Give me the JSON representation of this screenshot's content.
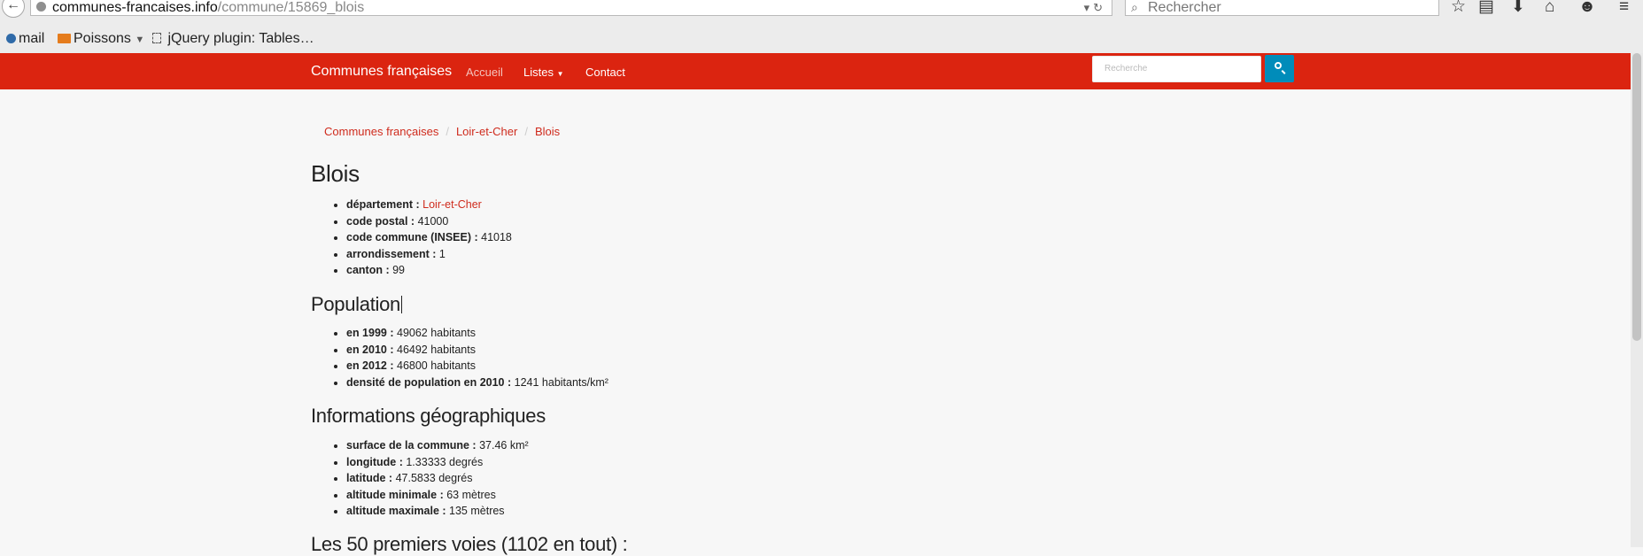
{
  "browser": {
    "url_host": "communes-francaises.info",
    "url_path": "/commune/15869_blois",
    "search_placeholder": "Rechercher",
    "bookmarks": [
      "mail",
      "Poissons",
      "jQuery plugin: Tables…"
    ]
  },
  "navbar": {
    "brand": "Communes françaises",
    "links": [
      "Accueil",
      "Listes",
      "Contact"
    ],
    "search_placeholder": "Recherche"
  },
  "breadcrumb": [
    "Communes françaises",
    "Loir-et-Cher",
    "Blois"
  ],
  "title": "Blois",
  "info": [
    {
      "label": "département :",
      "value": "Loir-et-Cher"
    },
    {
      "label": "code postal :",
      "value": "41000"
    },
    {
      "label": "code commune (INSEE) :",
      "value": "41018"
    },
    {
      "label": "arrondissement :",
      "value": "1"
    },
    {
      "label": "canton :",
      "value": "99"
    }
  ],
  "population": {
    "heading": "Population",
    "items": [
      {
        "label": "en 1999 :",
        "value": "49062 habitants"
      },
      {
        "label": "en 2010 :",
        "value": "46492 habitants"
      },
      {
        "label": "en 2012 :",
        "value": "46800 habitants"
      },
      {
        "label": "densité de population en 2010 :",
        "value": "1241 habitants/km²"
      }
    ]
  },
  "geo": {
    "heading": "Informations géographiques",
    "items": [
      {
        "label": "surface de la commune :",
        "value": "37.46 km²"
      },
      {
        "label": "longitude :",
        "value": "1.33333 degrés"
      },
      {
        "label": "latitude :",
        "value": "47.5833 degrés"
      },
      {
        "label": "altitude minimale :",
        "value": "63 mètres"
      },
      {
        "label": "altitude maximale :",
        "value": "135 mètres"
      }
    ]
  },
  "voies_heading": "Les 50 premiers voies (1102 en tout) :"
}
